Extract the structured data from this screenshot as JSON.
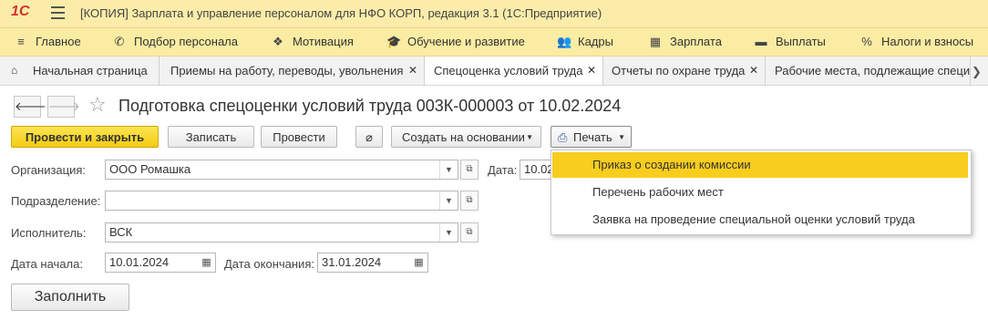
{
  "titlebar": {
    "logo": "1С",
    "title": "[КОПИЯ] Зарплата и управление персоналом для НФО КОРП, редакция 3.1  (1С:Предприятие)"
  },
  "menu": [
    {
      "label": "Главное",
      "icon": "≡"
    },
    {
      "label": "Подбор персонала",
      "icon": "✆"
    },
    {
      "label": "Мотивация",
      "icon": "❖"
    },
    {
      "label": "Обучение и развитие",
      "icon": "🎓"
    },
    {
      "label": "Кадры",
      "icon": "👥"
    },
    {
      "label": "Зарплата",
      "icon": "▦"
    },
    {
      "label": "Выплаты",
      "icon": "▬"
    },
    {
      "label": "Налоги и взносы",
      "icon": "%"
    }
  ],
  "tabs": [
    {
      "label": "Начальная страница"
    },
    {
      "label": "Приемы на работу, переводы, увольнения"
    },
    {
      "label": "Спецоценка условий труда"
    },
    {
      "label": "Отчеты по охране труда"
    },
    {
      "label": "Рабочие места, подлежащие специальной оценке"
    }
  ],
  "document": {
    "title": "Подготовка спецоценки условий труда 003К-000003 от 10.02.2024"
  },
  "toolbar": {
    "post_close": "Провести и закрыть",
    "save": "Записать",
    "post": "Провести",
    "create_based": "Создать на основании",
    "print": "Печать"
  },
  "form": {
    "org_label": "Организация:",
    "org_value": "ООО Ромашка",
    "date_label": "Дата:",
    "date_value": "10.02",
    "dept_label": "Подразделение:",
    "dept_value": "",
    "executor_label": "Исполнитель:",
    "executor_value": "ВСК",
    "start_label": "Дата начала:",
    "start_value": "10.01.2024",
    "end_label": "Дата окончания:",
    "end_value": "31.01.2024",
    "fill_button": "Заполнить"
  },
  "print_menu": [
    "Приказ о создании комиссии",
    "Перечень рабочих мест",
    "Заявка на проведение специальной оценки условий труда"
  ],
  "colors": {
    "titlebar_bg": "#fbeda9",
    "menubar_bg": "#fbeca3",
    "primary_button": "#f5d11b",
    "highlight": "#f8cd1e"
  }
}
